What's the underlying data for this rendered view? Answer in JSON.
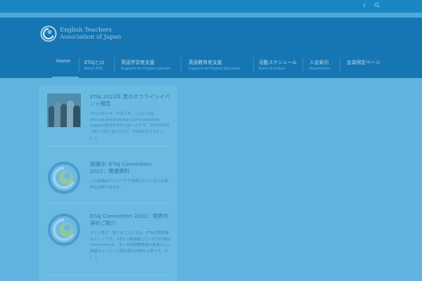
{
  "topbar": {
    "icons": [
      "facebook-icon",
      "search-icon"
    ]
  },
  "header": {
    "logo_line1": "English Teachers",
    "logo_line2": "Association of Japan"
  },
  "nav": [
    {
      "jp": "Home",
      "en": ""
    },
    {
      "jp": "ETAJとは",
      "en": "About ETAJ"
    },
    {
      "jp": "英語学習者支援",
      "en": "Supports for English Learners"
    },
    {
      "jp": "英語教育者支援",
      "en": "Supports for English Educators"
    },
    {
      "jp": "活動スケジュール",
      "en": "Event Schedule"
    },
    {
      "jp": "入会案内",
      "en": "Registration"
    },
    {
      "jp": "会員限定ページ",
      "en": ""
    }
  ],
  "posts": [
    {
      "title": "ETAJ 2023年 夏のオフラインイベント報告",
      "excerpt": "なわだめぐみ　みなさま、こんにちは。Internal and External Communication Support担当のなわだめぐみです。 2023年6月下旬〜7月上旬にかけて、ETAJのオフライン [...]"
    },
    {
      "title": "保護中: ETAJ Convention 2022：関連資料",
      "excerpt": "この投稿はパスワードで保護されているため抜粋文はありません。"
    },
    {
      "title": "ETAJ Convention 2022：発表内容のご紹介",
      "excerpt": "ミツイ直子　皆さまこんにちは。ETAJ代表理事のミツイです。 2年に1度開催していますETAJのConventionは、多くの英語教育者の素晴らしい英語ストーリーに耳を傾け共鳴する場です。今 [...]"
    }
  ]
}
